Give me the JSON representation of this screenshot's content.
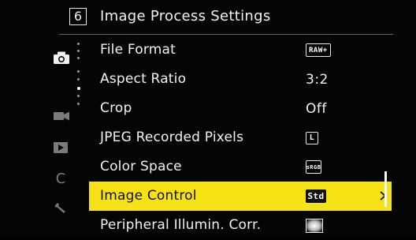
{
  "header": {
    "page_number": "6",
    "title": "Image Process Settings"
  },
  "sidebar": {
    "tabs": [
      {
        "icon": "camera-icon",
        "active": true
      },
      {
        "icon": "video-camera-icon",
        "active": false
      },
      {
        "icon": "playback-icon",
        "active": false
      },
      {
        "icon": "custom-c-icon",
        "active": false
      },
      {
        "icon": "wrench-icon",
        "active": false
      }
    ],
    "custom_tab_label": "C"
  },
  "menu": {
    "items": [
      {
        "label": "File Format",
        "value": "RAW+",
        "value_type": "badge"
      },
      {
        "label": "Aspect Ratio",
        "value": "3:2",
        "value_type": "text"
      },
      {
        "label": "Crop",
        "value": "Off",
        "value_type": "text"
      },
      {
        "label": "JPEG Recorded Pixels",
        "value": "L",
        "value_type": "badge"
      },
      {
        "label": "Color Space",
        "value": "sRGB",
        "value_type": "badge"
      },
      {
        "label": "Image Control",
        "value": "Std",
        "value_type": "badge",
        "selected": true
      },
      {
        "label": "Peripheral Illumin. Corr.",
        "value_icon": "vignette-icon",
        "value_type": "icon"
      }
    ]
  },
  "colors": {
    "highlight": "#f6e215",
    "background": "#050505",
    "text": "#f2f2f2"
  }
}
